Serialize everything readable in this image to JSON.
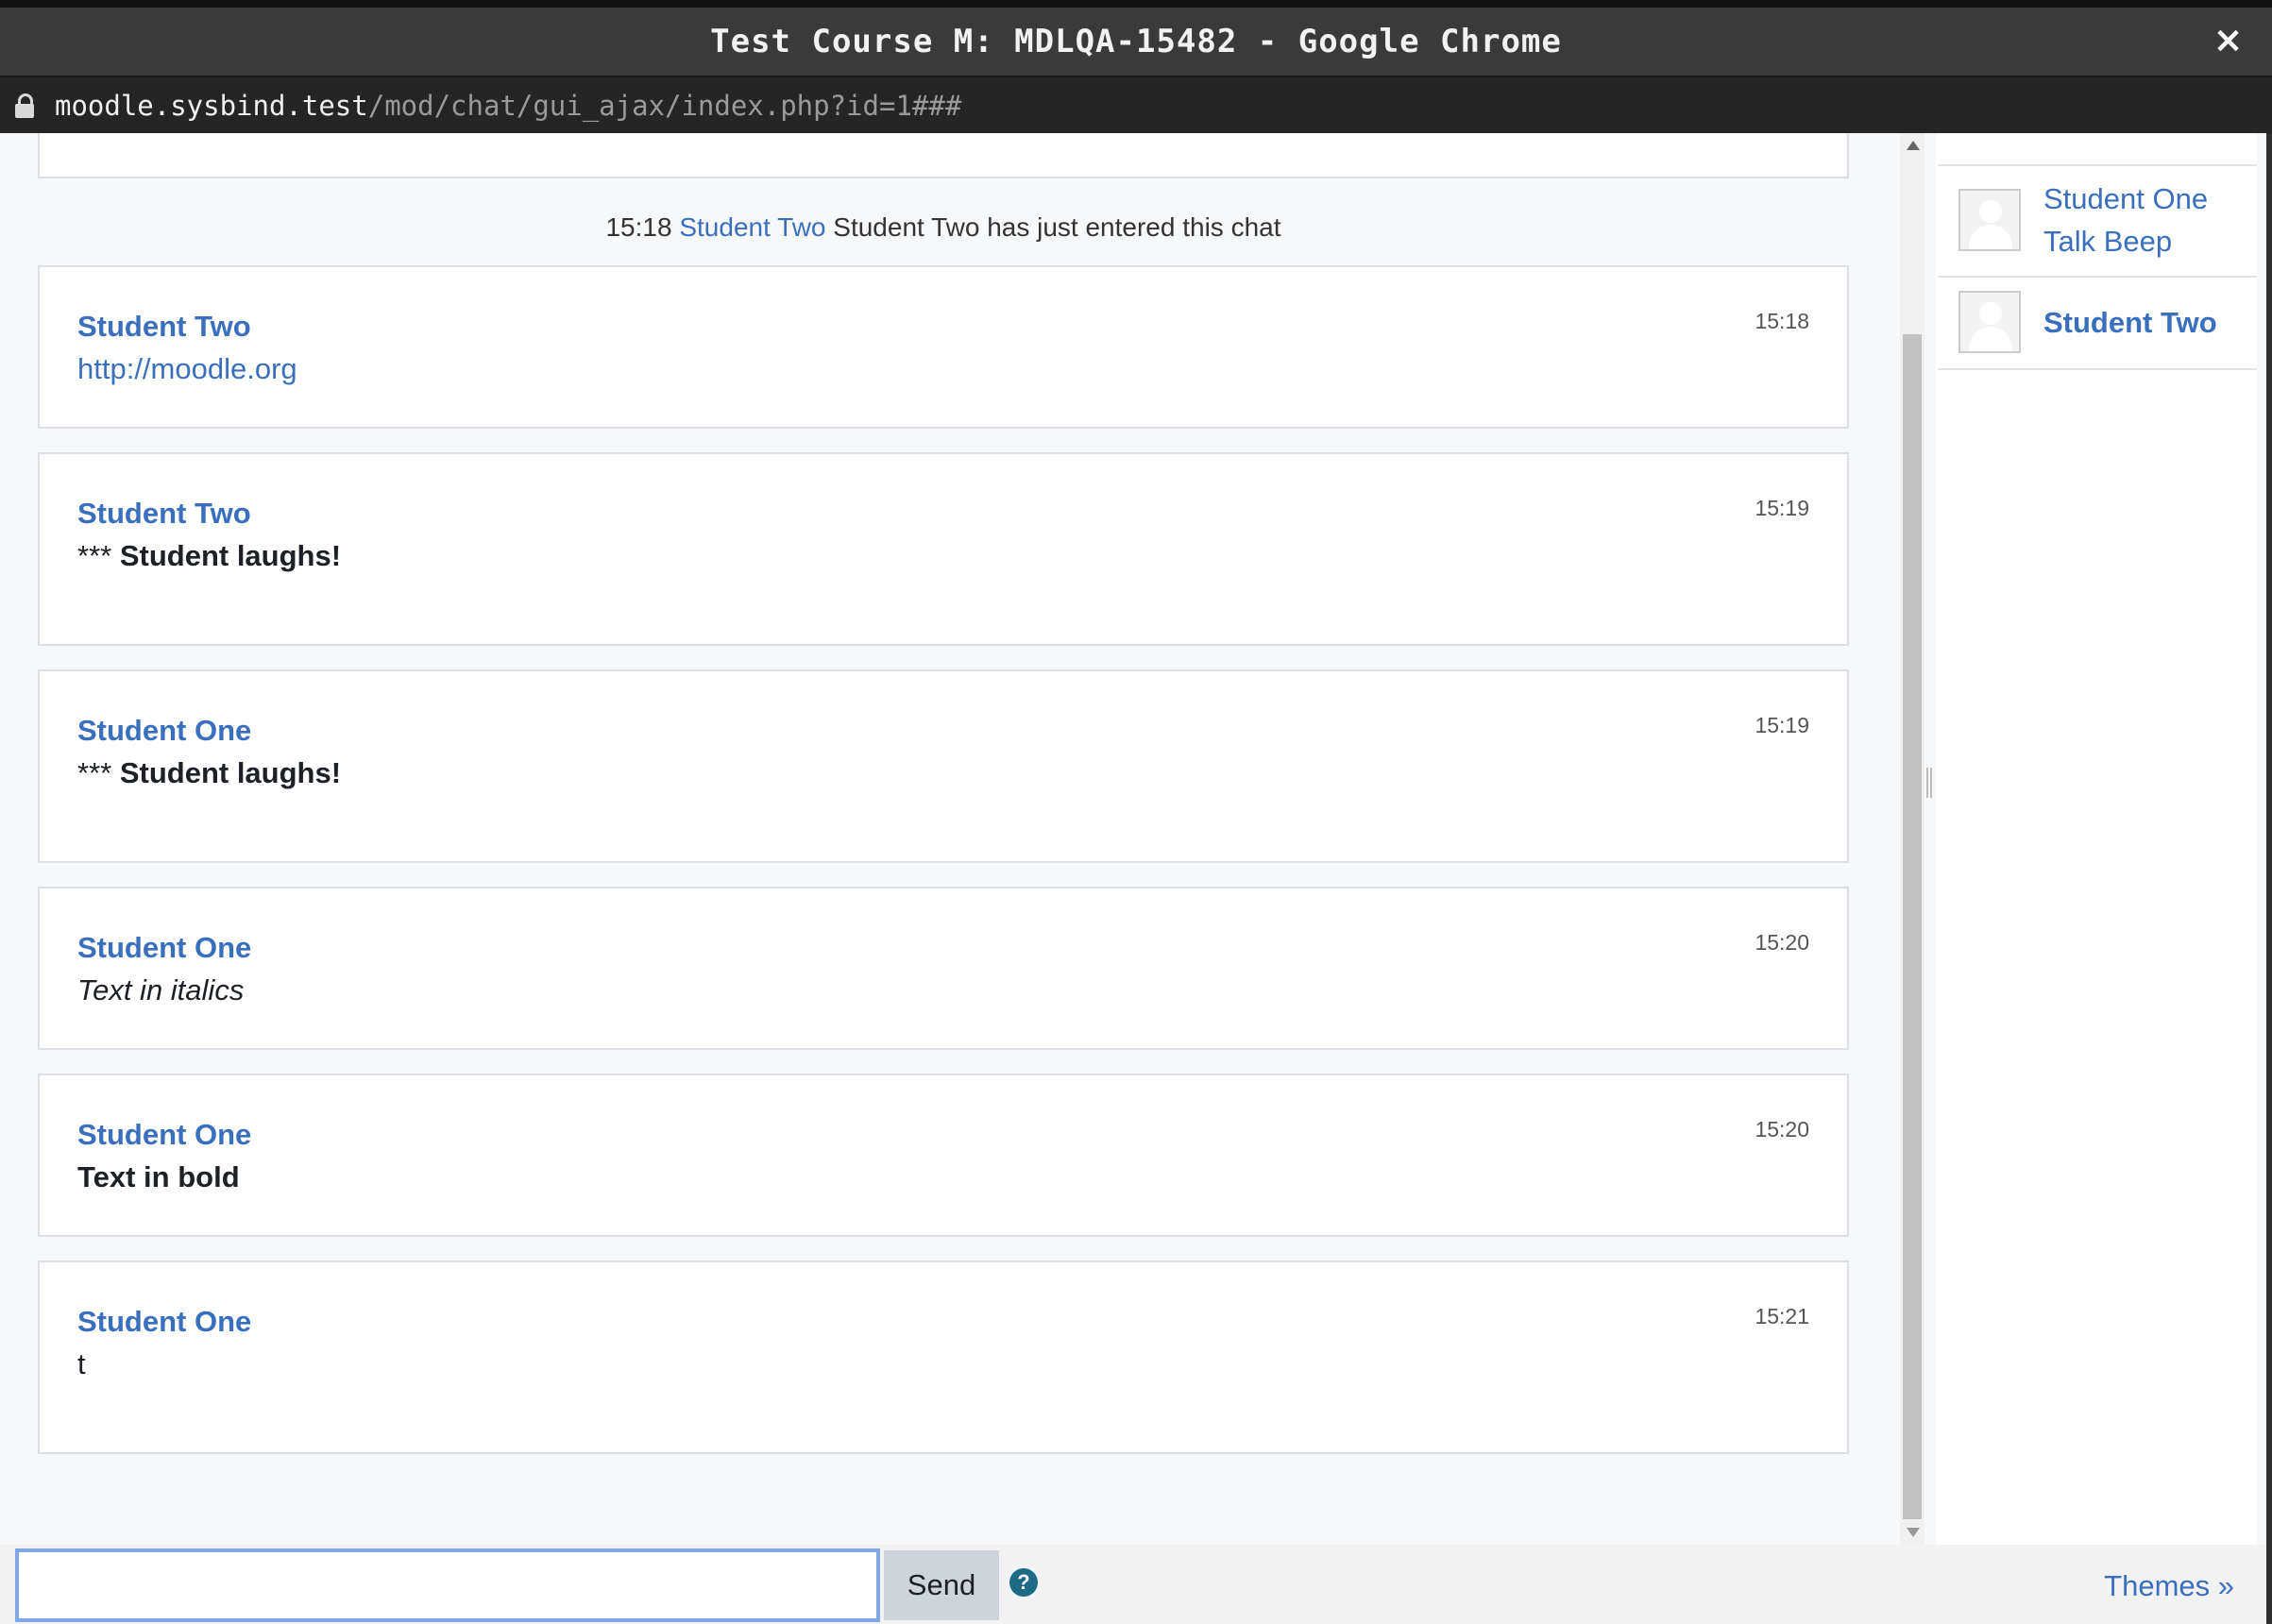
{
  "window": {
    "title": "Test Course M: MDLQA-15482 - Google Chrome",
    "close_label": "×"
  },
  "address_bar": {
    "host": "moodle.sysbind.test",
    "path": "/mod/chat/gui_ajax/index.php?id=1###"
  },
  "chat": {
    "notice": {
      "time": "15:18",
      "user": "Student Two",
      "text": "Student Two has just entered this chat"
    },
    "messages": [
      {
        "user": "Student Two",
        "time": "15:18",
        "text": "http://moodle.org",
        "style": "link"
      },
      {
        "user": "Student Two",
        "time": "15:19",
        "prefix": "***",
        "text": "Student laughs!",
        "style": "action"
      },
      {
        "user": "Student One",
        "time": "15:19",
        "prefix": "***",
        "text": "Student laughs!",
        "style": "action"
      },
      {
        "user": "Student One",
        "time": "15:20",
        "text": "Text in italics",
        "style": "italic"
      },
      {
        "user": "Student One",
        "time": "15:20",
        "text": "Text in bold",
        "style": "bold"
      },
      {
        "user": "Student One",
        "time": "15:21",
        "text": "t",
        "style": "plain"
      }
    ]
  },
  "users": [
    {
      "name_line1": "Student One",
      "name_line2": "Talk Beep"
    },
    {
      "name": "Student Two"
    }
  ],
  "input": {
    "value": "",
    "send_label": "Send",
    "help_label": "?",
    "themes_label": "Themes »"
  }
}
